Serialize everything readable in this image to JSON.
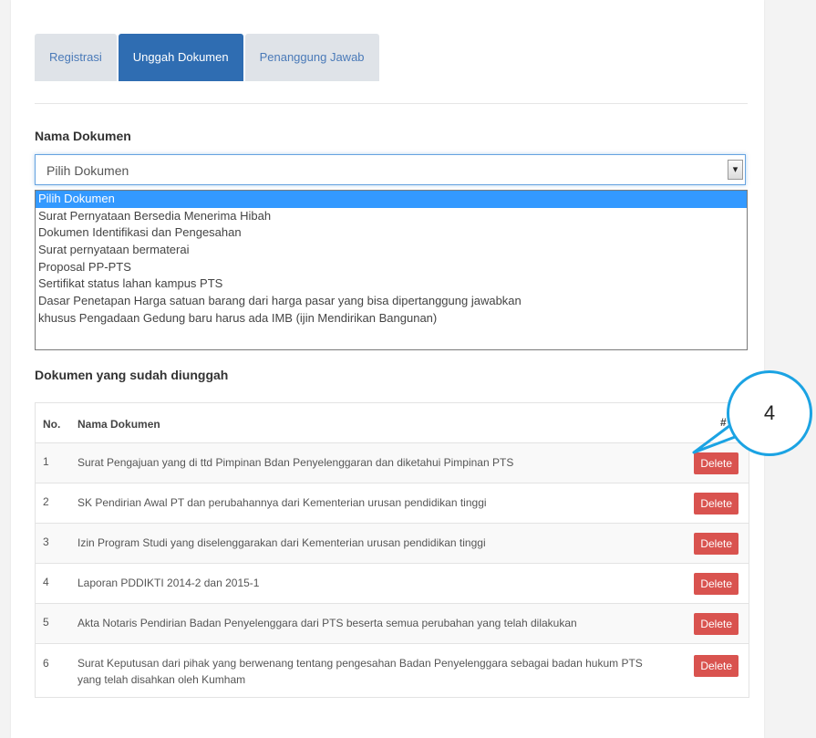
{
  "tabs": [
    "Registrasi",
    "Unggah Dokumen",
    "Penanggung Jawab"
  ],
  "active_tab": "Unggah Dokumen",
  "document_label": "Nama Dokumen",
  "select": {
    "value": "Pilih Dokumen",
    "arrow": "▾",
    "options": [
      "Pilih Dokumen",
      "Surat Pernyataan Bersedia Menerima Hibah",
      "Dokumen Identifikasi dan Pengesahan",
      "Surat pernyataan bermaterai",
      "Proposal PP-PTS",
      "Sertifikat status lahan kampus PTS",
      "Dasar Penetapan Harga satuan barang dari harga pasar yang bisa dipertanggung jawabkan",
      "khusus Pengadaan Gedung baru harus ada IMB (ijin Mendirikan Bangunan)"
    ]
  },
  "uploaded_label": "Dokumen yang sudah diunggah",
  "table": {
    "headers": {
      "no": "No.",
      "name": "Nama Dokumen",
      "hash": "#"
    },
    "rows": [
      {
        "no": "1",
        "name": "Surat Pengajuan yang di ttd Pimpinan Bdan Penyelenggaran dan diketahui Pimpinan PTS",
        "action": "Delete"
      },
      {
        "no": "2",
        "name": "SK Pendirian Awal PT dan perubahannya dari Kementerian urusan pendidikan tinggi",
        "action": "Delete"
      },
      {
        "no": "3",
        "name": "Izin Program Studi yang diselenggarakan dari Kementerian urusan pendidikan tinggi",
        "action": "Delete"
      },
      {
        "no": "4",
        "name": "Laporan PDDIKTI 2014-2 dan 2015-1",
        "action": "Delete"
      },
      {
        "no": "5",
        "name": "Akta Notaris Pendirian Badan Penyelenggara dari PTS beserta semua perubahan yang telah dilakukan",
        "action": "Delete"
      },
      {
        "no": "6",
        "name": "Surat Keputusan dari pihak yang berwenang tentang pengesahan Badan Penyelenggara sebagai badan hukum PTS yang telah disahkan oleh Kumham",
        "action": "Delete"
      }
    ]
  },
  "callout": {
    "number": "4",
    "color": "#1ba3e3"
  }
}
